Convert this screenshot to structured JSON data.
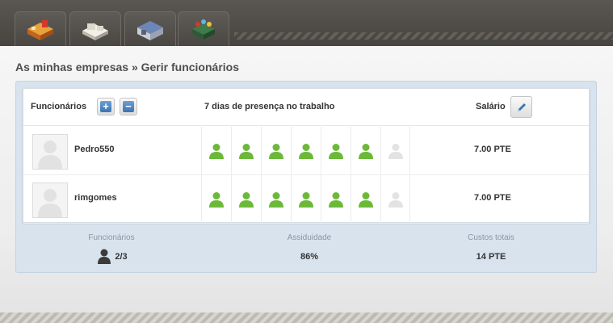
{
  "nav": {
    "tabs": [
      {
        "icon": "company-building-icon"
      },
      {
        "icon": "factory-icon"
      },
      {
        "icon": "warehouse-icon"
      },
      {
        "icon": "market-stand-icon"
      }
    ]
  },
  "breadcrumb": "As minhas empresas » Gerir funcionários",
  "table": {
    "header": {
      "employees_label": "Funcionários",
      "add_icon": "plus-icon",
      "remove_icon": "minus-icon",
      "presence_label": "7 dias de presença no trabalho",
      "salary_label": "Salário",
      "edit_icon": "pencil-icon"
    },
    "rows": [
      {
        "name": "Pedro550",
        "presence": [
          true,
          true,
          true,
          true,
          true,
          true,
          false
        ],
        "salary": "7.00 PTE"
      },
      {
        "name": "rimgomes",
        "presence": [
          true,
          true,
          true,
          true,
          true,
          true,
          false
        ],
        "salary": "7.00 PTE"
      }
    ]
  },
  "summary": {
    "employees": {
      "label": "Funcionários",
      "value": "2/3",
      "icon": "person-icon"
    },
    "attendance": {
      "label": "Assiduidade",
      "value": "86%"
    },
    "total_costs": {
      "label": "Custos totais",
      "value": "14 PTE"
    }
  },
  "colors": {
    "present": "#6cb93a",
    "absent": "#e3e3e3",
    "accent_blue": "#3a74b3",
    "summary_bg": "#d8e3ee"
  }
}
